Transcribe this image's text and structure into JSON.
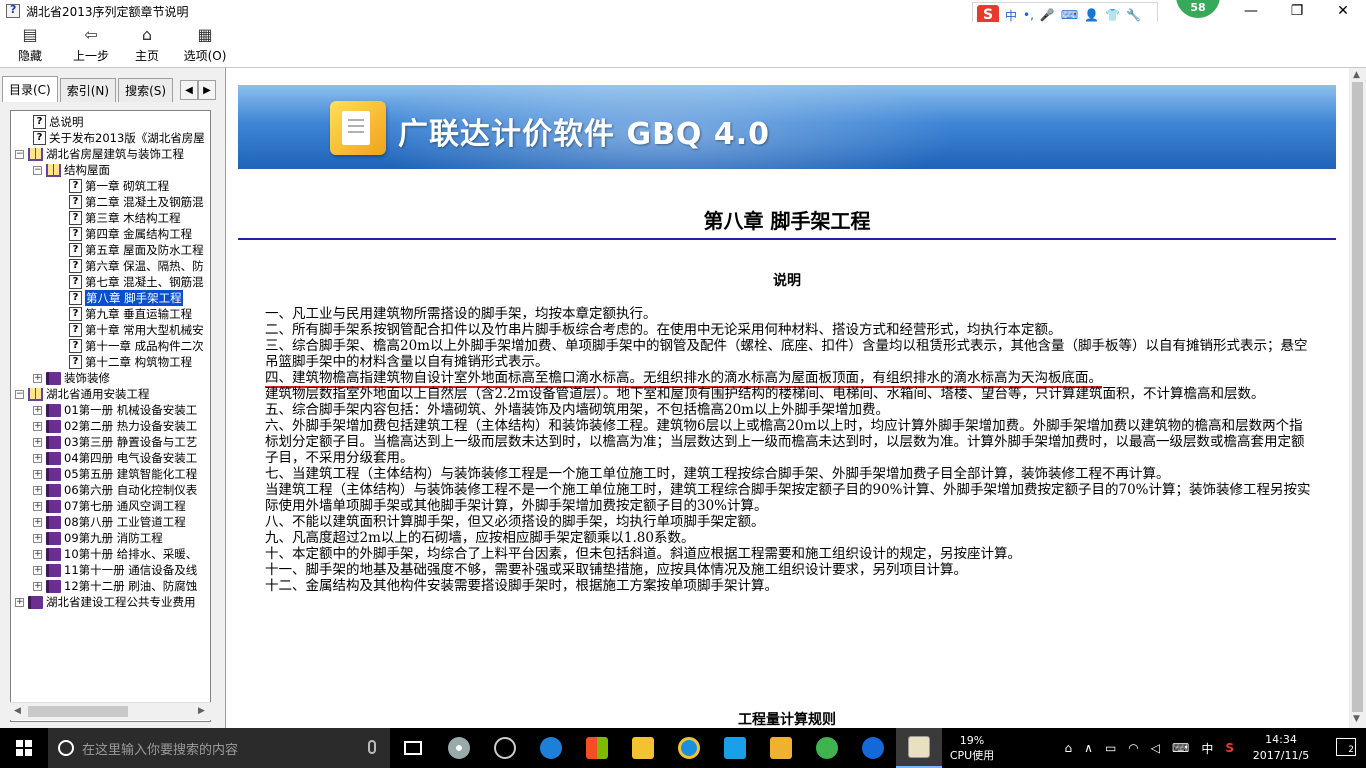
{
  "window": {
    "title": "湖北省2013序列定额章节说明"
  },
  "ime": {
    "mode": "中",
    "punct": "•,",
    "badge": "58"
  },
  "window_controls": {
    "minimize": "—",
    "maximize": "❐",
    "close": "✕"
  },
  "toolbar": {
    "hide_label": "隐藏",
    "back_label": "上一步",
    "home_label": "主页",
    "options_label": "选项(O)"
  },
  "tabs": {
    "contents": "目录(C)",
    "index": "索引(N)",
    "search": "搜索(S)"
  },
  "tree": [
    {
      "label": "总说明",
      "type": "page",
      "level": 2
    },
    {
      "label": "关于发布2013版《湖北省房屋",
      "type": "page",
      "level": 2
    },
    {
      "label": "湖北省房屋建筑与装饰工程",
      "type": "book-open",
      "level": 0,
      "expander": "−"
    },
    {
      "label": "结构屋面",
      "type": "book-open",
      "level": 1,
      "expander": "−"
    },
    {
      "label": "第一章 砌筑工程",
      "type": "page",
      "level": 3
    },
    {
      "label": "第二章 混凝土及钢筋混",
      "type": "page",
      "level": 3
    },
    {
      "label": "第三章 木结构工程",
      "type": "page",
      "level": 3
    },
    {
      "label": "第四章 金属结构工程",
      "type": "page",
      "level": 3
    },
    {
      "label": "第五章 屋面及防水工程",
      "type": "page",
      "level": 3
    },
    {
      "label": "第六章 保温、隔热、防",
      "type": "page",
      "level": 3
    },
    {
      "label": "第七章 混凝土、钢筋混",
      "type": "page",
      "level": 3
    },
    {
      "label": "第八章 脚手架工程",
      "type": "page",
      "level": 3,
      "selected": true
    },
    {
      "label": "第九章 垂直运输工程",
      "type": "page",
      "level": 3
    },
    {
      "label": "第十章 常用大型机械安",
      "type": "page",
      "level": 3
    },
    {
      "label": "第十一章 成品构件二次",
      "type": "page",
      "level": 3
    },
    {
      "label": "第十二章 构筑物工程",
      "type": "page",
      "level": 3
    },
    {
      "label": "装饰装修",
      "type": "book-closed",
      "level": 1,
      "expander": "+"
    },
    {
      "label": "湖北省通用安装工程",
      "type": "book-open",
      "level": 0,
      "expander": "−"
    },
    {
      "label": "01第一册 机械设备安装工",
      "type": "book-closed",
      "level": 1,
      "expander": "+"
    },
    {
      "label": "02第二册 热力设备安装工",
      "type": "book-closed",
      "level": 1,
      "expander": "+"
    },
    {
      "label": "03第三册 静置设备与工艺",
      "type": "book-closed",
      "level": 1,
      "expander": "+"
    },
    {
      "label": "04第四册 电气设备安装工",
      "type": "book-closed",
      "level": 1,
      "expander": "+"
    },
    {
      "label": "05第五册 建筑智能化工程",
      "type": "book-closed",
      "level": 1,
      "expander": "+"
    },
    {
      "label": "06第六册 自动化控制仪表",
      "type": "book-closed",
      "level": 1,
      "expander": "+"
    },
    {
      "label": "07第七册 通风空调工程",
      "type": "book-closed",
      "level": 1,
      "expander": "+"
    },
    {
      "label": "08第八册 工业管道工程",
      "type": "book-closed",
      "level": 1,
      "expander": "+"
    },
    {
      "label": "09第九册 消防工程",
      "type": "book-closed",
      "level": 1,
      "expander": "+"
    },
    {
      "label": "10第十册 给排水、采暖、",
      "type": "book-closed",
      "level": 1,
      "expander": "+"
    },
    {
      "label": "11第十一册 通信设备及线",
      "type": "book-closed",
      "level": 1,
      "expander": "+"
    },
    {
      "label": "12第十二册 刷油、防腐蚀",
      "type": "book-closed",
      "level": 1,
      "expander": "+"
    },
    {
      "label": "湖北省建设工程公共专业费用",
      "type": "book-closed",
      "level": 0,
      "expander": "+"
    }
  ],
  "content": {
    "banner_title": "广联达计价软件 GBQ 4.0",
    "chapter_title": "第八章 脚手架工程",
    "section_title": "说明",
    "section2_title": "工程量计算规则",
    "para4_underlined": "四、建筑物檐高指建筑物自设计室外地面标高至檐口滴水标高。无组织排水的滴水标高为屋面板顶面，有组织排水的滴水标高为天沟板底面。",
    "paragraphs": [
      "一、凡工业与民用建筑物所需搭设的脚手架，均按本章定额执行。",
      "二、所有脚手架系按钢管配合扣件以及竹串片脚手板综合考虑的。在使用中无论采用何种材料、搭设方式和经营形式，均执行本定额。",
      "三、综合脚手架、檐高20m以上外脚手架增加费、单项脚手架中的钢管及配件（螺栓、底座、扣件）含量均以租赁形式表示，其他含量（脚手板等）以自有摊销形式表示；悬空吊篮脚手架中的材料含量以自有摊销形式表示。",
      "建筑物层数指室外地面以上自然层（含2.2m设备管道层）。地下室和屋顶有围护结构的楼梯间、电梯间、水箱间、塔楼、望台等，只计算建筑面积，不计算檐高和层数。",
      "五、综合脚手架内容包括：外墙砌筑、外墙装饰及内墙砌筑用架，不包括檐高20m以上外脚手架增加费。",
      "六、外脚手架增加费包括建筑工程（主体结构）和装饰装修工程。建筑物6层以上或檐高20m以上时，均应计算外脚手架增加费。外脚手架增加费以建筑物的檐高和层数两个指标划分定额子目。当檐高达到上一级而层数未达到时，以檐高为准；当层数达到上一级而檐高未达到时，以层数为准。计算外脚手架增加费时，以最高一级层数或檐高套用定额子目，不采用分级套用。",
      "七、当建筑工程（主体结构）与装饰装修工程是一个施工单位施工时，建筑工程按综合脚手架、外脚手架增加费子目全部计算，装饰装修工程不再计算。",
      "当建筑工程（主体结构）与装饰装修工程不是一个施工单位施工时，建筑工程综合脚手架按定额子目的90%计算、外脚手架增加费按定额子目的70%计算；装饰装修工程另按实际使用外墙单项脚手架或其他脚手架计算，外脚手架增加费按定额子目的30%计算。",
      "八、不能以建筑面积计算脚手架，但又必须搭设的脚手架，均执行单项脚手架定额。",
      "九、凡高度超过2m以上的石砌墙，应按相应脚手架定额乘以1.80系数。",
      "十、本定额中的外脚手架，均综合了上料平台因素，但未包括斜道。斜道应根据工程需要和施工组织设计的规定，另按座计算。",
      "十一、脚手架的地基及基础强度不够，需要补强或采取铺垫措施，应按具体情况及施工组织设计要求，另列项目计算。",
      "十二、金属结构及其他构件安装需要搭设脚手架时，根据施工方案按单项脚手架计算。"
    ],
    "accent_color": "#2222aa",
    "underline_color": "#d81e1e"
  },
  "taskbar": {
    "search_placeholder": "在这里输入你要搜索的内容",
    "cpu_percent": "19%",
    "cpu_label": "CPU使用",
    "ime_indicator": "中",
    "time": "14:34",
    "date": "2017/11/5",
    "notifications": "2"
  }
}
